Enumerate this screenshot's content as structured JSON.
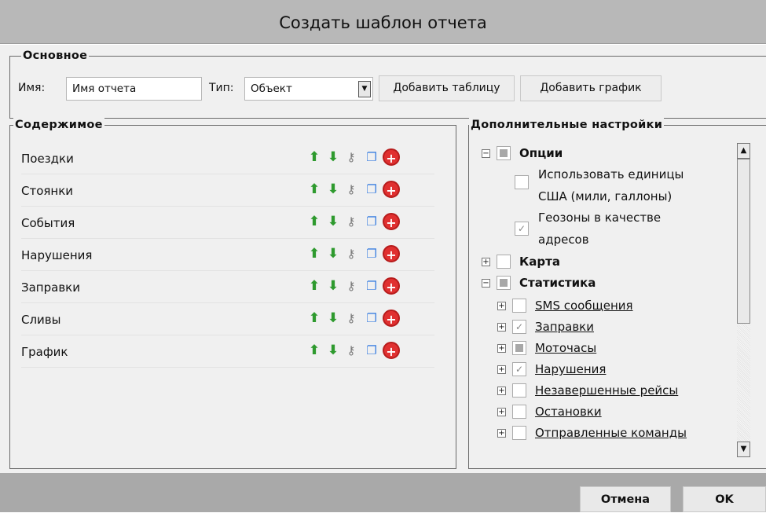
{
  "dialog": {
    "title": "Создать шаблон отчета"
  },
  "basic": {
    "legend": "Основное",
    "name_label": "Имя:",
    "name_value": "Имя отчета",
    "type_label": "Тип:",
    "type_value": "Объект",
    "add_table": "Добавить таблицу",
    "add_chart": "Добавить график"
  },
  "content": {
    "legend": "Содержимое",
    "items": [
      "Поездки",
      "Стоянки",
      "События",
      "Нарушения",
      "Заправки",
      "Сливы",
      "График"
    ]
  },
  "extra": {
    "legend": "Дополнительные настройки",
    "options": "Опции",
    "us_units_1": "Использовать единицы",
    "us_units_2": "США (мили, галлоны)",
    "geozones_1": "Геозоны в качестве",
    "geozones_2": "адресов",
    "map": "Карта",
    "stats": "Статистика",
    "stat_items": [
      "SMS сообщения",
      "Заправки",
      "Моточасы",
      "Нарушения",
      "Незавершенные рейсы",
      "Остановки",
      "Отправленные команды"
    ]
  },
  "footer": {
    "cancel": "Отмена",
    "ok": "OK"
  }
}
